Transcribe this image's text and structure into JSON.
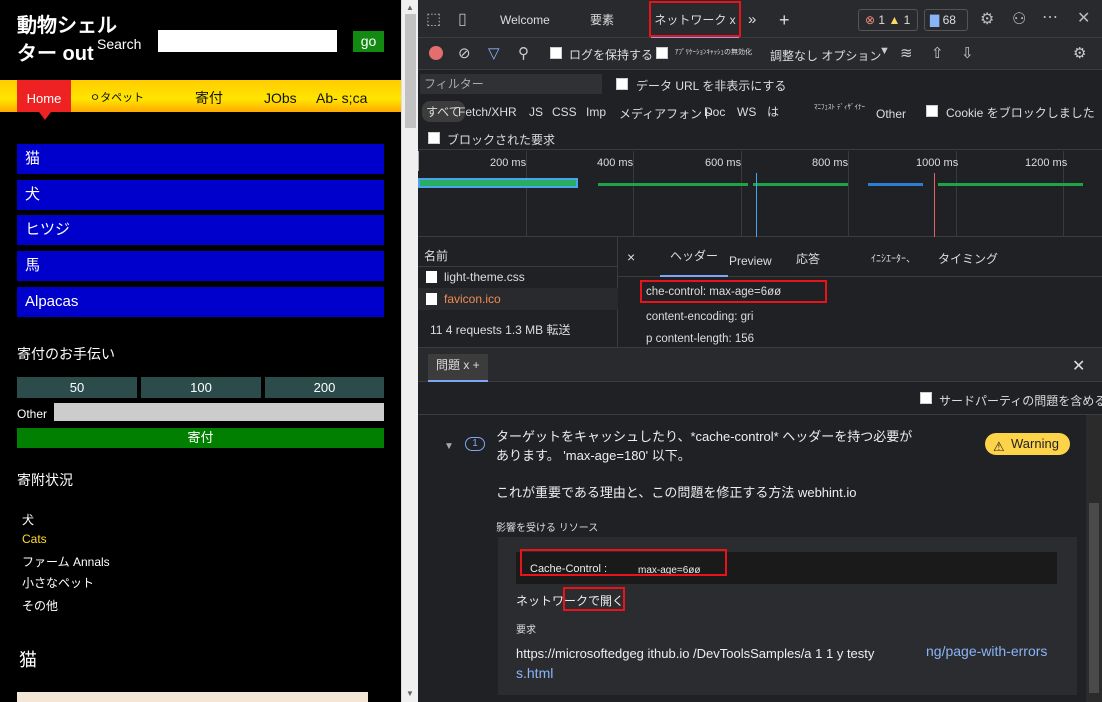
{
  "page": {
    "site_title": "動物シェルター out",
    "search_label": "Search",
    "go_label": "go",
    "nav": {
      "home": "Home",
      "pets": "ㅇタペット",
      "donate": "寄付",
      "jobs": "JObs",
      "about": "Ab- s;ca"
    },
    "animals": [
      "猫",
      "犬",
      "ヒツジ",
      "馬",
      "Alpacas"
    ],
    "help_title": "寄付のお手伝い",
    "amounts": [
      "50",
      "100",
      "200"
    ],
    "other_label": "Other",
    "donate_button": "寄付",
    "status_title": "寄附状況",
    "status_items": [
      "犬",
      "Cats",
      "ファーム Annals",
      "小さなペット",
      "その他"
    ],
    "cat_heading": "猫"
  },
  "devtools": {
    "tabs": {
      "welcome": "Welcome",
      "elements": "要素",
      "network": "ネットワーク x",
      "more": "»",
      "add": "+"
    },
    "badges": {
      "errors": "1",
      "warnings": "1",
      "messages": "68"
    },
    "toolbar": {
      "preserve_log": "ログを保持する",
      "disable_cache": "ｱﾌﾟﾘｹｰｼｮﾝｷｬｯｼｭの無効化",
      "throttling": "調整なし オプション"
    },
    "filter": {
      "placeholder": "フィルター",
      "hide_data_urls": "データ URL を非表示にする"
    },
    "types": {
      "all": "すべて",
      "fetch": "Fetch/XHR",
      "js": "JS",
      "css": "CSS",
      "img": "Imp",
      "media": "メディア",
      "font": "フォント",
      "doc": "Doc",
      "ws": "WS",
      "wasm": "は",
      "manifest": "ﾏﾆﾌｪｽﾄ ﾃﾞｨｻﾞｲﾅｰ",
      "other": "Other",
      "blocked_cookies": "Cookie をブロックしました",
      "blocked_requests": "ブロックされた要求"
    },
    "timeline": {
      "ticks": [
        "200 ms",
        "400 ms",
        "600 ms",
        "800 ms",
        "1000 ms",
        "1200 ms"
      ]
    },
    "requests": {
      "header": "名前",
      "rows": [
        "light-theme.css",
        "favicon.ico"
      ],
      "summary": "11 4 requests 1.3  MB 転送"
    },
    "detail": {
      "close": "×",
      "tabs": [
        "ヘッダー",
        "Preview",
        "応答",
        "ｲﾆｼｴｰﾀｰ、",
        "タイミング"
      ],
      "headers": [
        "che-control: max-age=6øø",
        "content-encoding: gri",
        "p content-length: 156"
      ]
    },
    "issues": {
      "tab": "問題 x +",
      "third_party": "サードパーティの問題を含める",
      "count": "1",
      "title": "ターゲットをキャッシュしたり、*cache-control* ヘッダーを持つ必要があります。 'max-age=180' 以下。",
      "warning": "Warning",
      "why": "これが重要である理由と、この問題を修正する方法 webhint.io",
      "affected": "影響を受ける リソース",
      "cc_key": "Cache-Control :",
      "cc_val": "max-age=6øø",
      "open_network": "ネットワークで開く",
      "request_label": "要求",
      "url_text": "https://microsoftedgeg ithub.io /DevToolsSamples/a 1 1 y testy",
      "url_link": "ng/page-with-errors",
      "url_link2": "s.html"
    }
  }
}
